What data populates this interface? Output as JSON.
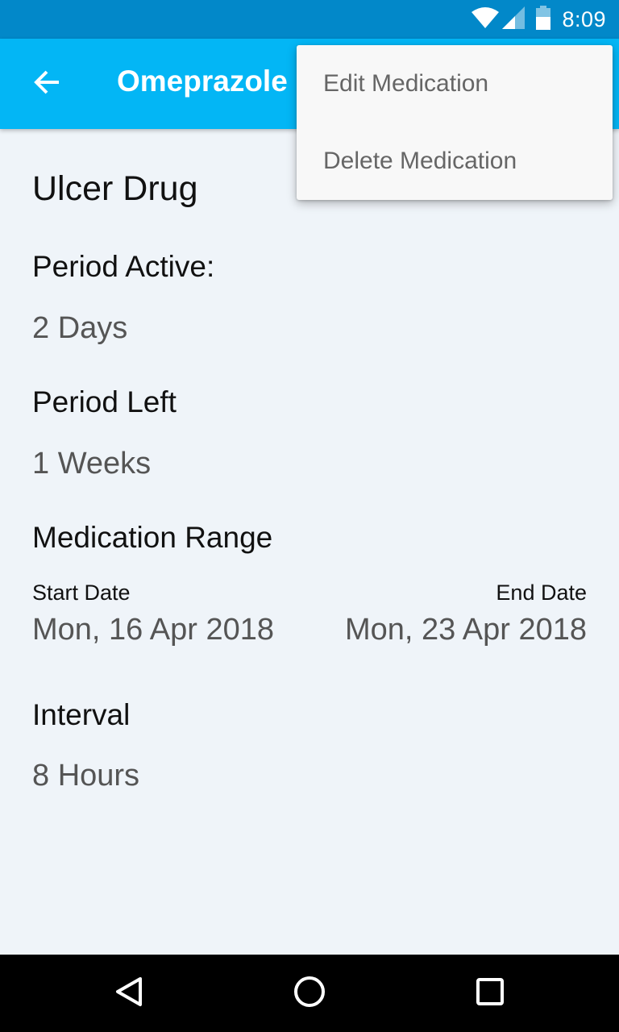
{
  "status_bar": {
    "time": "8:09",
    "icons": [
      "wifi-icon",
      "signal-icon",
      "battery-icon"
    ]
  },
  "app_bar": {
    "back_icon": "arrow-back-icon",
    "title": "Omeprazole"
  },
  "overflow_menu": {
    "items": [
      {
        "label": "Edit Medication"
      },
      {
        "label": "Delete Medication"
      }
    ]
  },
  "details": {
    "drug_class": "Ulcer Drug",
    "period_active": {
      "label": "Period Active:",
      "value": "2 Days"
    },
    "period_left": {
      "label": "Period Left",
      "value": "1 Weeks"
    },
    "medication_range": {
      "label": "Medication Range",
      "start": {
        "label": "Start Date",
        "value": "Mon, 16 Apr 2018"
      },
      "end": {
        "label": "End Date",
        "value": "Mon, 23 Apr 2018"
      }
    },
    "interval": {
      "label": "Interval",
      "value": "8 Hours"
    }
  },
  "nav_bar": {
    "icons": [
      "back-triangle-icon",
      "home-circle-icon",
      "recents-square-icon"
    ]
  },
  "colors": {
    "status_bar": "#0288c9",
    "app_bar": "#03b6f5",
    "background": "#eff4f9"
  }
}
